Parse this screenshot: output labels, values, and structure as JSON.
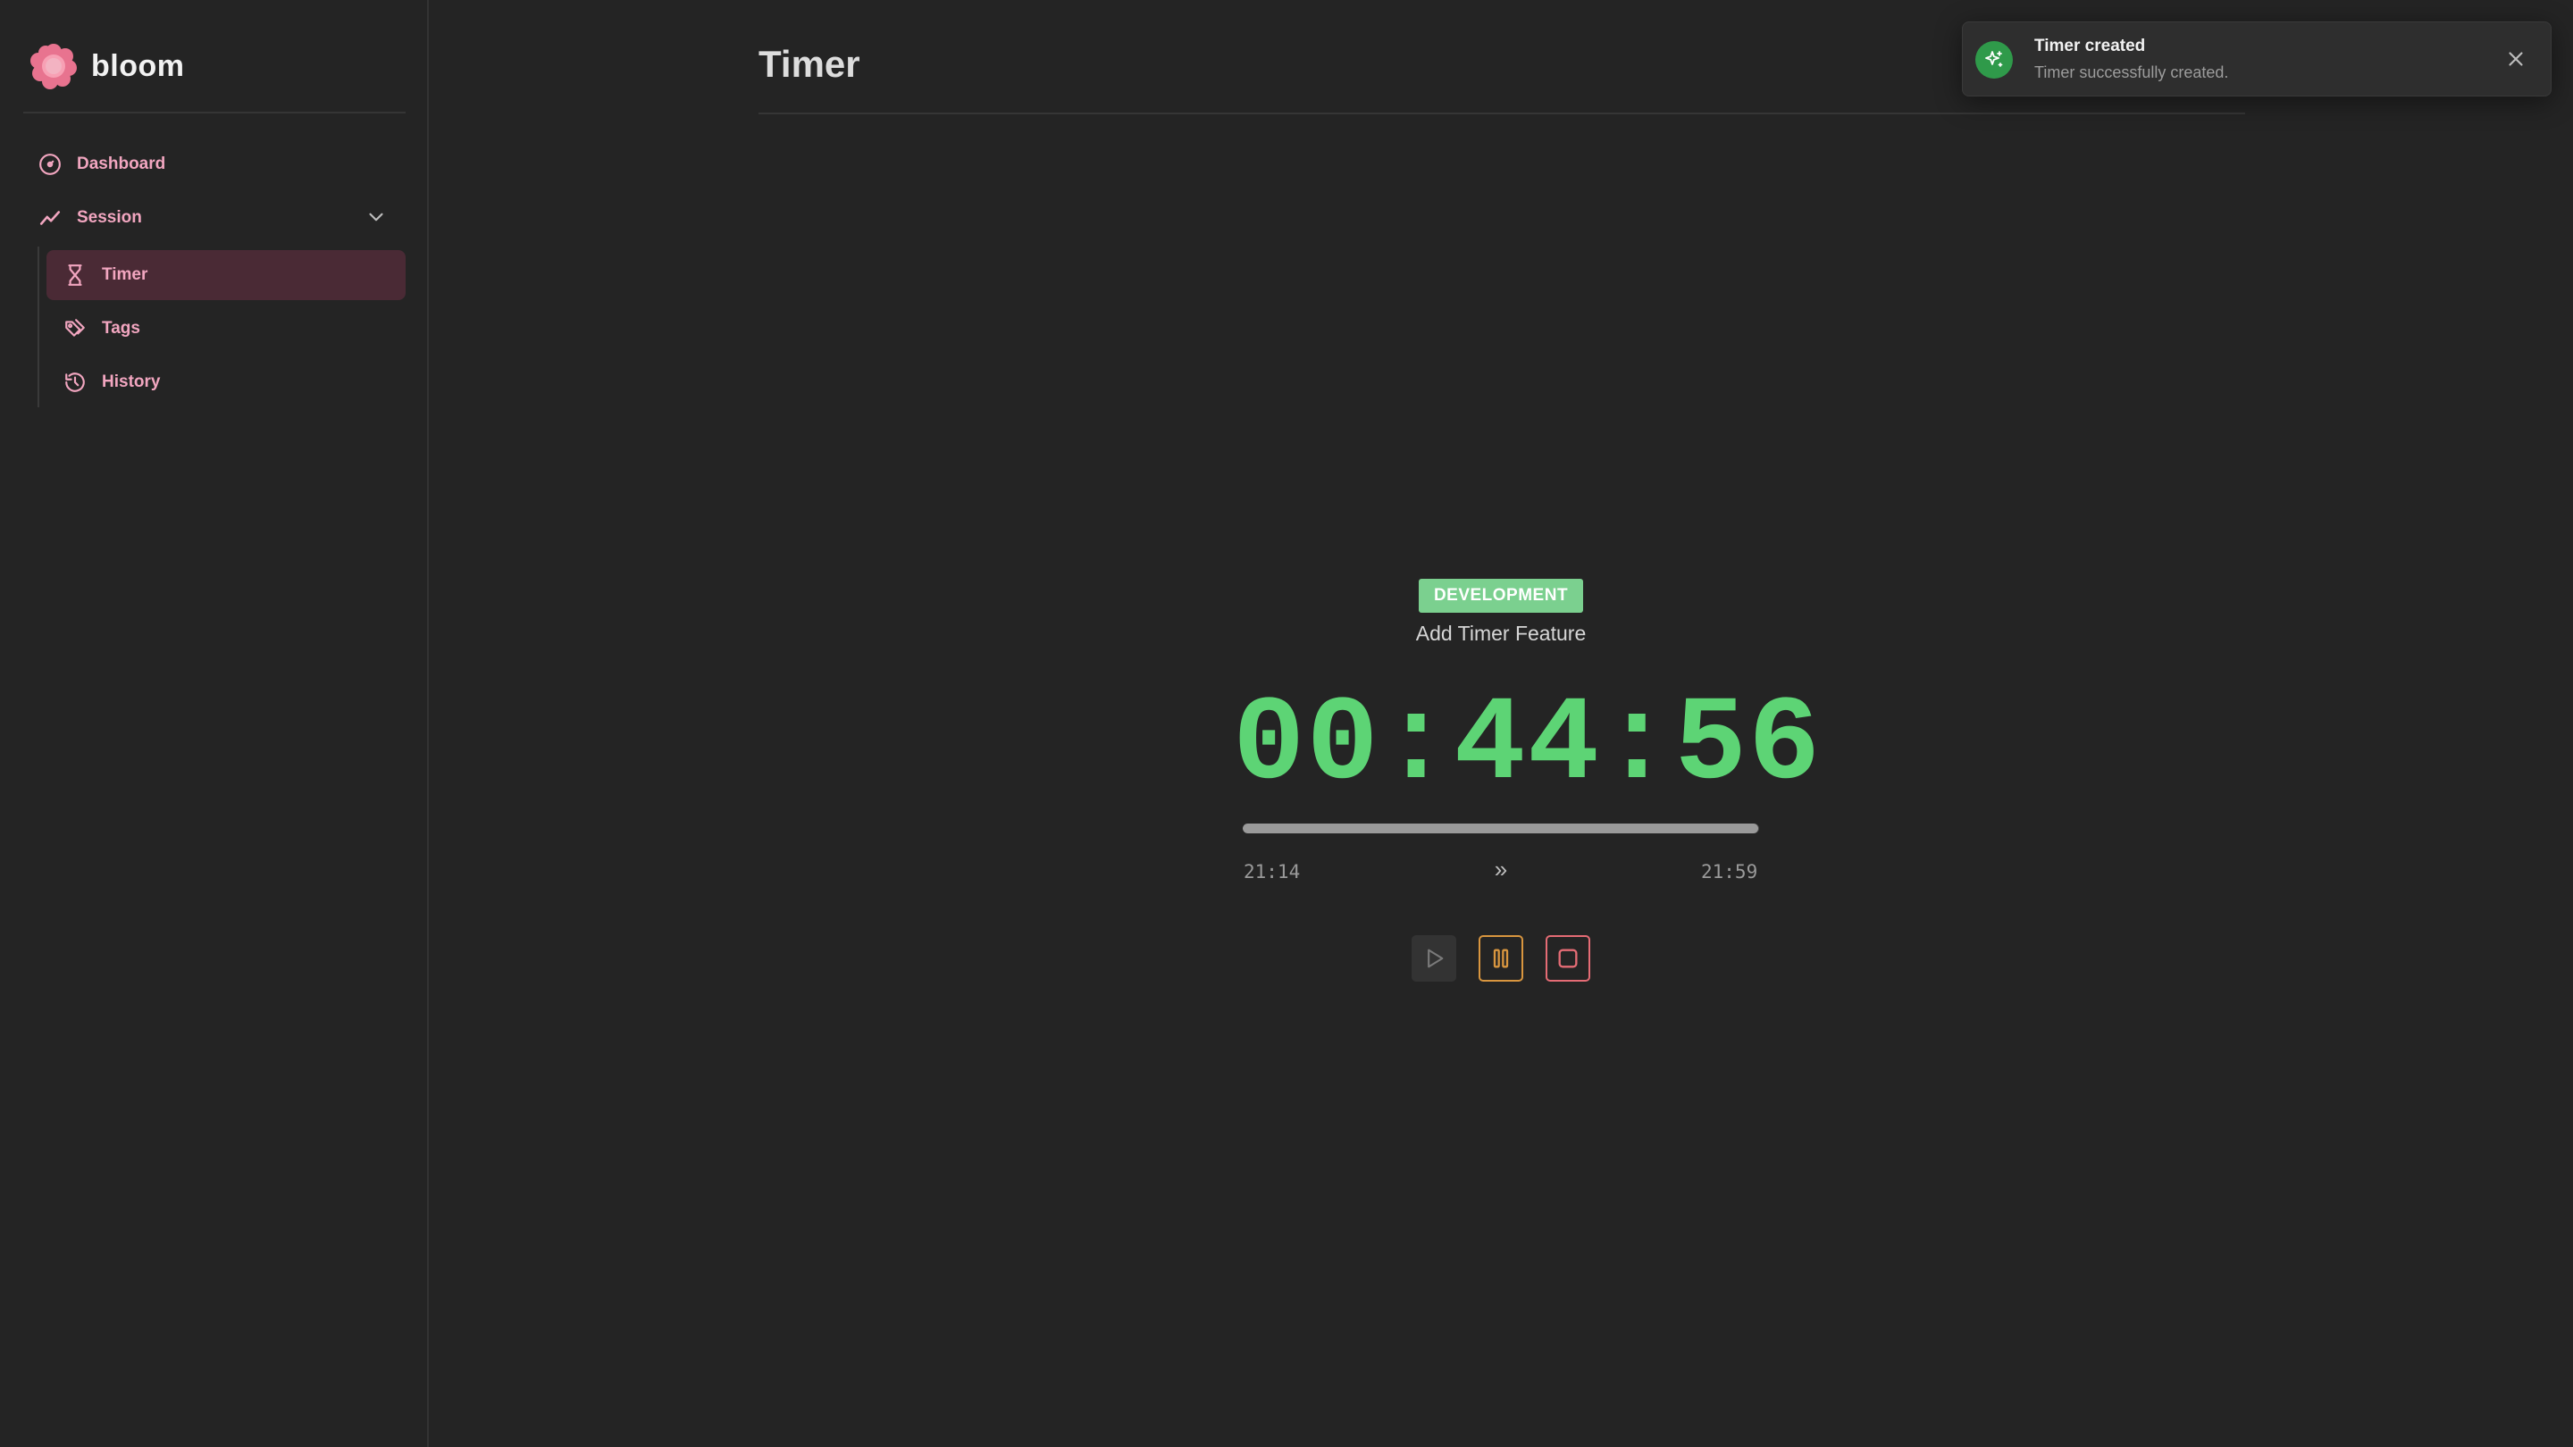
{
  "app": {
    "name": "bloom",
    "logo_icon": "flower-icon"
  },
  "sidebar": {
    "items": [
      {
        "label": "Dashboard",
        "icon": "gauge-icon"
      },
      {
        "label": "Session",
        "icon": "trend-line-icon",
        "expanded": true
      }
    ],
    "subitems": [
      {
        "label": "Timer",
        "icon": "hourglass-icon",
        "active": true
      },
      {
        "label": "Tags",
        "icon": "tags-icon"
      },
      {
        "label": "History",
        "icon": "history-icon"
      }
    ]
  },
  "header": {
    "title": "Timer"
  },
  "timer": {
    "tag": "DEVELOPMENT",
    "tag_color": "#7bd08f",
    "task": "Add Timer Feature",
    "clock": "00:44:56",
    "clock_color": "#5dd475",
    "start_time": "21:14",
    "end_time": "21:59",
    "progress": 0.999,
    "controls": {
      "play_icon": "play-icon",
      "pause_icon": "pause-icon",
      "stop_icon": "stop-icon"
    }
  },
  "toast": {
    "title": "Timer created",
    "message": "Timer successfully created.",
    "icon": "sparkles-icon"
  },
  "colors": {
    "accent_pink": "#f2a6c0",
    "active_bg": "#4a2a35",
    "pause_orange": "#d9963f",
    "stop_red": "#e56c75",
    "success_green": "#2f9a4a"
  }
}
